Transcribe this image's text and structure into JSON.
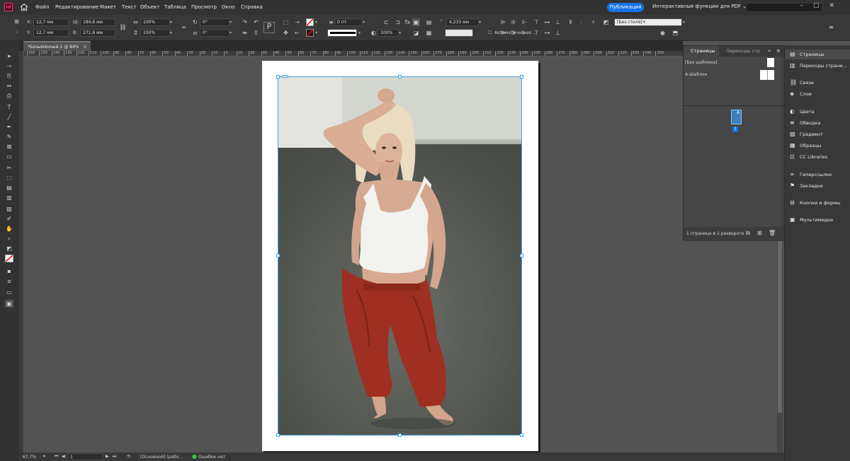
{
  "menubar": {
    "logo": "Id",
    "items": [
      "Файл",
      "Редактирование",
      "Макет",
      "Текст",
      "Объект",
      "Таблица",
      "Просмотр",
      "Окно",
      "Справка"
    ],
    "publish_label": "Публикация",
    "workspace_label": "Интерактивные функции для PDF"
  },
  "controlbar": {
    "x_label": "X:",
    "x_value": "12,7 мм",
    "y_label": "Y:",
    "y_value": "12,7 мм",
    "w_label": "Ш:",
    "w_value": "184,6 мм",
    "h_label": "В:",
    "h_value": "271,6 мм",
    "scale_x": "100%",
    "scale_y": "100%",
    "rotate": "0°",
    "shear": "0°",
    "stroke_weight": "0 пт",
    "ref_size": "4,233 мм",
    "opacity": "100%",
    "auto_label": "Автоматическая ...",
    "style_value": "[Без стиля]+"
  },
  "document": {
    "tab_title": "*Безымянный-1 @ 84%",
    "close": "×"
  },
  "ruler_labels": [
    "160",
    "150",
    "140",
    "130",
    "120",
    "110",
    "100",
    "90",
    "80",
    "70",
    "60",
    "50",
    "40",
    "30",
    "20",
    "10",
    "0",
    "10",
    "20",
    "30",
    "40",
    "50",
    "60",
    "70",
    "80",
    "90",
    "100",
    "110",
    "120",
    "130",
    "140",
    "150",
    "160",
    "170",
    "180",
    "190",
    "200",
    "210",
    "220",
    "230",
    "240",
    "250",
    "260",
    "270",
    "280",
    "290",
    "300",
    "310",
    "320",
    "330",
    "340",
    "350"
  ],
  "pages_panel": {
    "tab_pages": "Страницы",
    "tab_transitions": "Переходы стр",
    "no_master": "[Без шаблона]",
    "master_a": "А-Шаблон",
    "page_number": "1",
    "footer": "1 страница в 1 развороте"
  },
  "dock": [
    {
      "label": "Страницы",
      "icon": "pages-icon"
    },
    {
      "label": "Переходы страни...",
      "icon": "transitions-icon"
    },
    {
      "label": "Связи",
      "icon": "links-icon"
    },
    {
      "label": "Слои",
      "icon": "layers-icon"
    },
    {
      "label": "Цвета",
      "icon": "color-icon"
    },
    {
      "label": "Обводка",
      "icon": "stroke-icon"
    },
    {
      "label": "Градиент",
      "icon": "gradient-icon"
    },
    {
      "label": "Образцы",
      "icon": "swatches-icon"
    },
    {
      "label": "CC Libraries",
      "icon": "cc-libraries-icon"
    },
    {
      "label": "Гиперссылки",
      "icon": "hyperlinks-icon"
    },
    {
      "label": "Закладки",
      "icon": "bookmarks-icon"
    },
    {
      "label": "Кнопки и формы",
      "icon": "buttons-forms-icon"
    },
    {
      "label": "Мультимедиа",
      "icon": "media-icon"
    }
  ],
  "status": {
    "zoom": "67,7%",
    "page": "1",
    "style": "[Основной] (рабо...",
    "errors": "Ошибок нет"
  },
  "colors": {
    "accent": "#1473e6",
    "frame": "#4aa3e0",
    "pants": "#9e2f22",
    "floor": "#5a5d58",
    "ok": "#2ecc40"
  }
}
